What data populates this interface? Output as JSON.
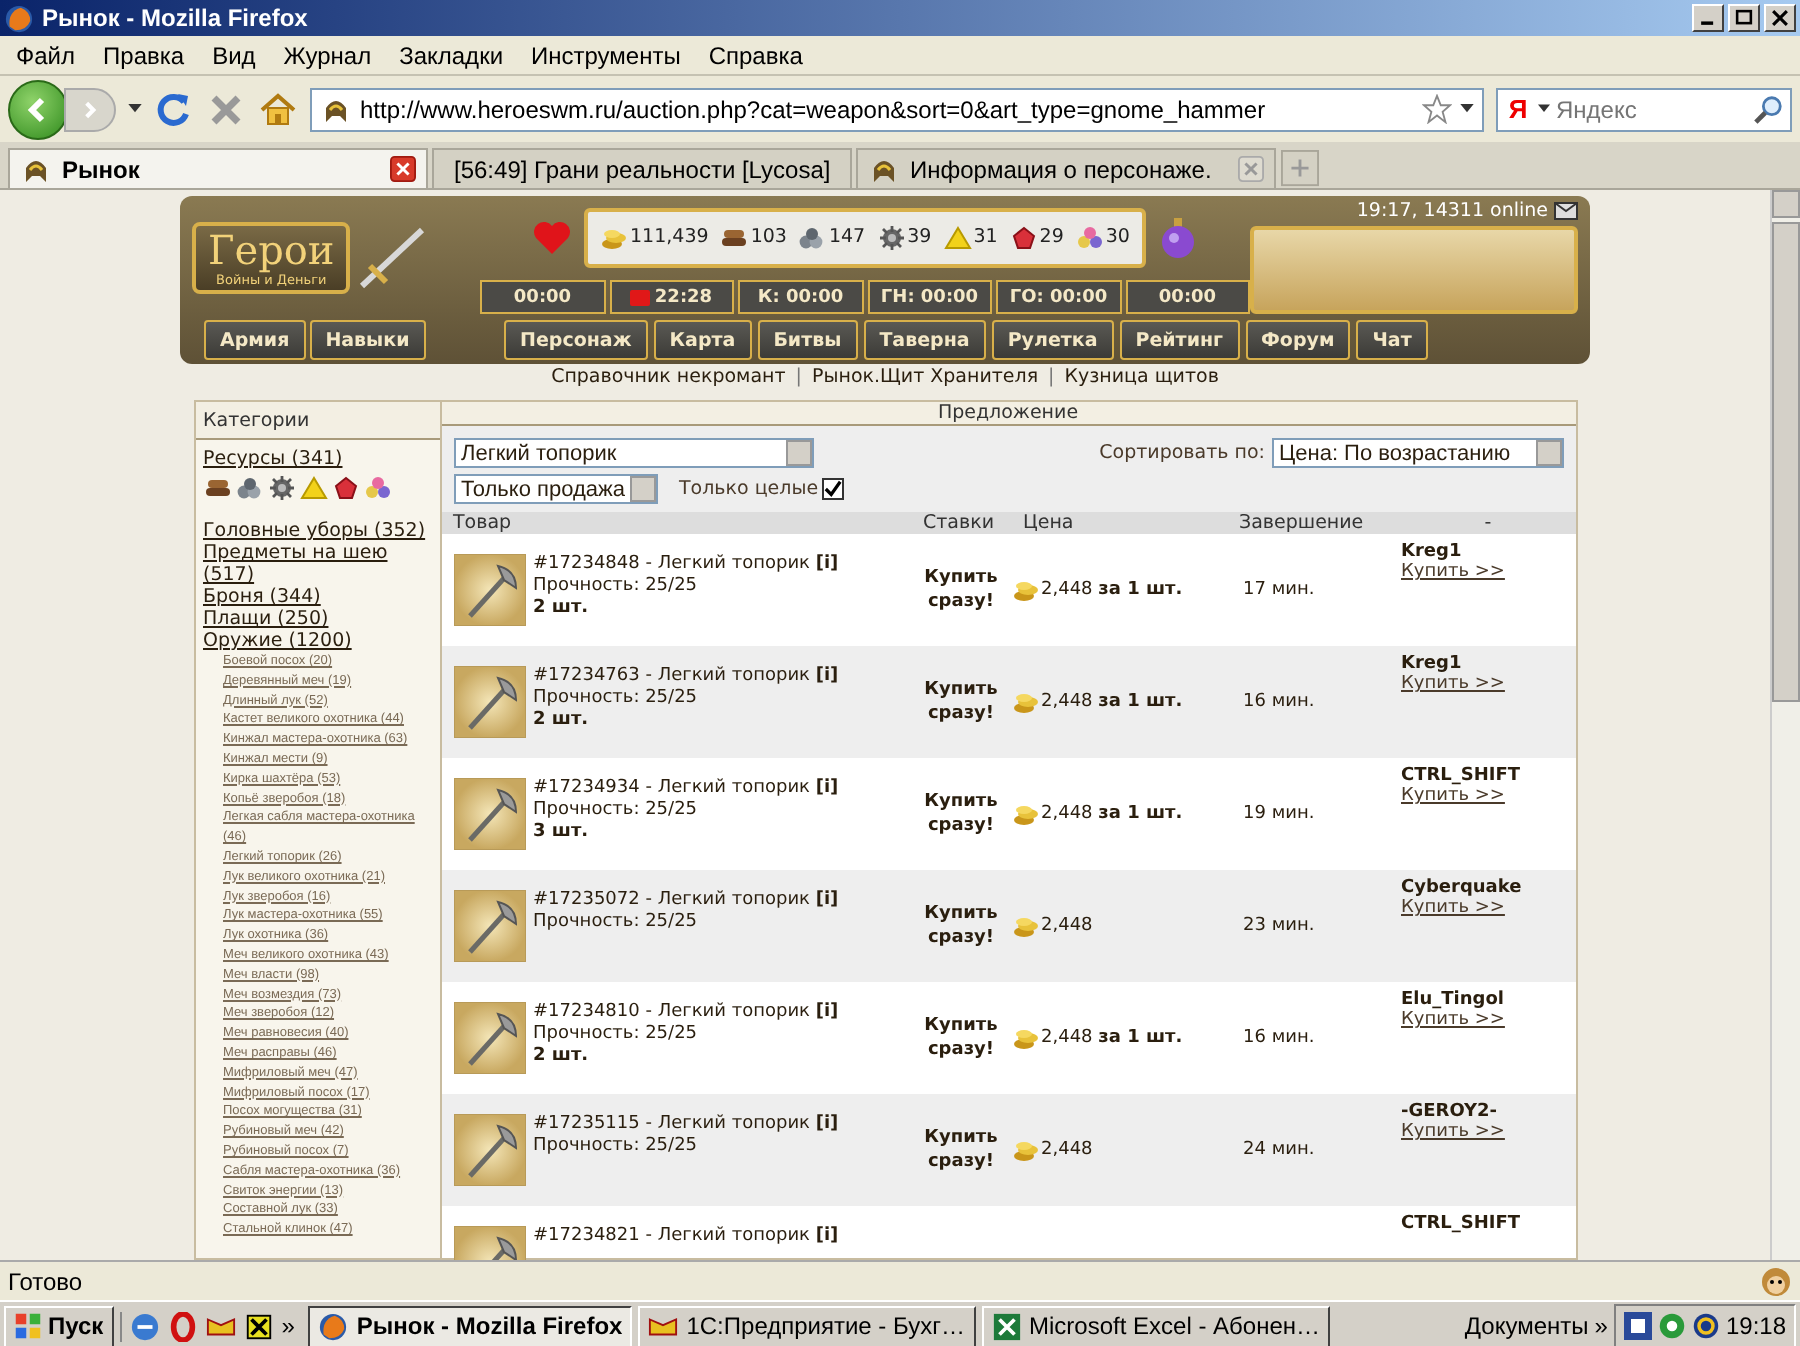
{
  "window": {
    "title": "Рынок - Mozilla Firefox"
  },
  "menu": [
    "Файл",
    "Правка",
    "Вид",
    "Журнал",
    "Закладки",
    "Инструменты",
    "Справка"
  ],
  "address_bar": {
    "url": "http://www.heroeswm.ru/auction.php?cat=weapon&sort=0&art_type=gnome_hammer"
  },
  "search": {
    "engine_logo": "Я",
    "placeholder": "Яндекс"
  },
  "tabs": [
    {
      "label": "Рынок",
      "selected": true
    },
    {
      "label": "[56:49] Грани реальности [Lycosa]",
      "selected": false
    },
    {
      "label": "Информация о персонаже.",
      "selected": false
    }
  ],
  "game": {
    "logo_title": "Герои",
    "logo_subtitle": "Войны и Деньги",
    "resources": [
      {
        "kind": "gold",
        "amount": "111,439"
      },
      {
        "kind": "wood",
        "amount": "103"
      },
      {
        "kind": "ore",
        "amount": "147"
      },
      {
        "kind": "mercury",
        "amount": "39"
      },
      {
        "kind": "sulfur",
        "amount": "31"
      },
      {
        "kind": "crystal",
        "amount": "29"
      },
      {
        "kind": "gems",
        "amount": "30"
      }
    ],
    "status": "19:17, 14311 online",
    "timers": [
      {
        "text": "00:00",
        "alert": false
      },
      {
        "text": "22:28",
        "alert": true
      },
      {
        "text": "К: 00:00",
        "alert": false
      },
      {
        "text": "ГН: 00:00",
        "alert": false
      },
      {
        "text": "ГО: 00:00",
        "alert": false
      },
      {
        "text": "00:00",
        "alert": false
      }
    ],
    "side_buttons": [
      "Армия",
      "Навыки"
    ],
    "nav": [
      "Персонаж",
      "Карта",
      "Битвы",
      "Таверна",
      "Рулетка",
      "Рейтинг",
      "Форум",
      "Чат"
    ],
    "links": [
      {
        "kind": "link",
        "text": "Справочник некромант"
      },
      {
        "kind": "separator",
        "text": "|"
      },
      {
        "kind": "link",
        "text": "Рынок.Щит Хранителя"
      },
      {
        "kind": "separator",
        "text": "|"
      },
      {
        "kind": "link",
        "text": "Кузница щитов"
      }
    ]
  },
  "categories": {
    "heading": "Категории",
    "resources_link": "Ресурсы (341)",
    "resource_icons": [
      {
        "kind": "wood"
      },
      {
        "kind": "ore"
      },
      {
        "kind": "mercury"
      },
      {
        "kind": "sulfur"
      },
      {
        "kind": "crystal"
      },
      {
        "kind": "gems"
      }
    ],
    "main": [
      "Головные уборы (352)",
      "Предметы на шею (517)",
      "Броня (344)",
      "Плащи (250)",
      "Оружие (1200)"
    ],
    "sub": [
      "Боевой посох (20)",
      "Деревянный меч (19)",
      "Длинный лук (52)",
      "Кастет великого охотника (44)",
      "Кинжал мастера-охотника (63)",
      "Кинжал мести (9)",
      "Кирка шахтёра (53)",
      "Копьё зверобоя (18)",
      "Легкая сабля мастера-охотника (46)",
      "Легкий топорик (26)",
      "Лук великого охотника (21)",
      "Лук зверобоя (16)",
      "Лук мастера-охотника (55)",
      "Лук охотника (36)",
      "Меч великого охотника (43)",
      "Меч власти (98)",
      "Меч возмездия (73)",
      "Меч зверобоя (12)",
      "Меч равновесия (40)",
      "Меч расправы (46)",
      "Мифриловый меч (47)",
      "Мифриловый посох (17)",
      "Посох могущества (31)",
      "Рубиновый меч (42)",
      "Рубиновый посох (7)",
      "Сабля мастера-охотника (36)",
      "Свиток энергии (13)",
      "Составной лук (33)",
      "Стальной клинок (47)"
    ]
  },
  "offers": {
    "heading": "Предложение",
    "item_filter": "Легкий топорик",
    "sale_filter": "Только продажа",
    "whole_only": {
      "label": "Только целые",
      "checked": true
    },
    "sort_label": "Сортировать по:",
    "sort_value": "Цена: По возрастанию",
    "columns": [
      "Товар",
      "Ставки",
      "Цена",
      "Завершение",
      "-"
    ],
    "rows": [
      {
        "title": "#17234848 - Легкий топорик **[i]**",
        "durability": "Прочность: 25/25",
        "quantity": "2 шт.",
        "bid": "Купить сразу!",
        "price": "2,448 **за 1 шт.**",
        "ends": "17 мин.",
        "seller": "Kreg1",
        "action": "Купить >>"
      },
      {
        "title": "#17234763 - Легкий топорик **[i]**",
        "durability": "Прочность: 25/25",
        "quantity": "2 шт.",
        "bid": "Купить сразу!",
        "price": "2,448 **за 1 шт.**",
        "ends": "16 мин.",
        "seller": "Kreg1",
        "action": "Купить >>"
      },
      {
        "title": "#17234934 - Легкий топорик **[i]**",
        "durability": "Прочность: 25/25",
        "quantity": "3 шт.",
        "bid": "Купить сразу!",
        "price": "2,448 **за 1 шт.**",
        "ends": "19 мин.",
        "seller": "CTRL_SHIFT",
        "action": "Купить >>"
      },
      {
        "title": "#17235072 - Легкий топорик **[i]**",
        "durability": "Прочность: 25/25",
        "bid": "Купить сразу!",
        "price": "2,448",
        "ends": "23 мин.",
        "seller": "Cyberquake",
        "action": "Купить >>"
      },
      {
        "title": "#17234810 - Легкий топорик **[i]**",
        "durability": "Прочность: 25/25",
        "quantity": "2 шт.",
        "bid": "Купить сразу!",
        "price": "2,448 **за 1 шт.**",
        "ends": "16 мин.",
        "seller": "Elu_Tingol",
        "action": "Купить >>"
      },
      {
        "title": "#17235115 - Легкий топорик **[i]**",
        "durability": "Прочность: 25/25",
        "bid": "Купить сразу!",
        "price": "2,448",
        "ends": "24 мин.",
        "seller": "-GEROY2-",
        "action": "Купить >>"
      },
      {
        "title": "#17234821 - Легкий топорик **[i]**",
        "seller": "CTRL_SHIFT"
      }
    ]
  },
  "status_bar": {
    "text": "Готово"
  },
  "taskbar": {
    "start": "Пуск",
    "quick_more": "»",
    "tasks": [
      {
        "kind": "firefox",
        "label": "Рынок - Mozilla Firefox",
        "selected": true
      },
      {
        "kind": "app",
        "label": "1С:Предприятие - Бухг…",
        "selected": false
      },
      {
        "kind": "excel",
        "label": "Microsoft Excel - Абонен…",
        "selected": false
      }
    ],
    "toolbar": "Документы",
    "toolbar_more": "»",
    "clock": "19:18"
  }
}
